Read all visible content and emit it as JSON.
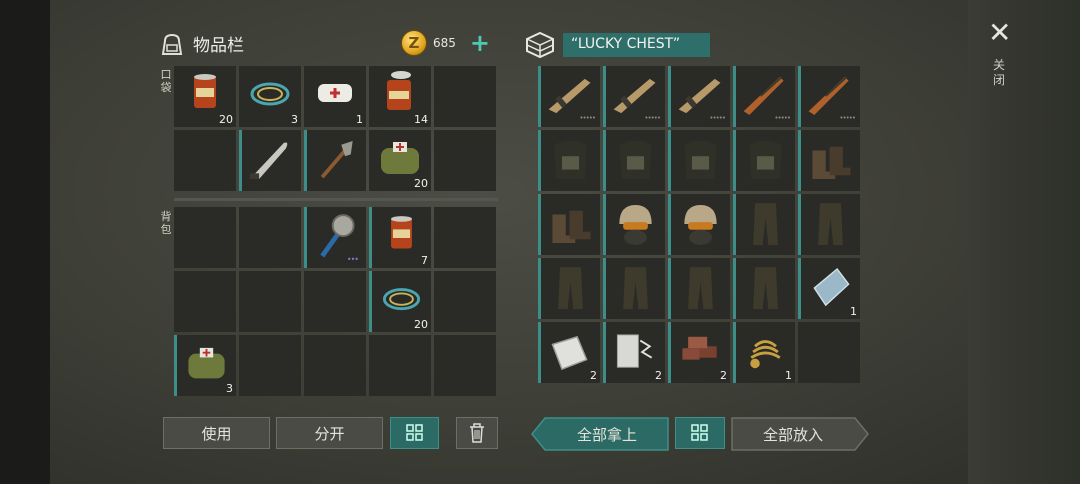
{
  "header": {
    "inventory_title": "物品栏",
    "coins": "685",
    "coin_symbol": "Z",
    "add_label": "+",
    "chest_name": "“LUCKY CHEST”"
  },
  "labels": {
    "pocket": "口袋",
    "backpack": "背包",
    "close": "关闭"
  },
  "pocket": [
    {
      "item": "canned-food",
      "qty": "20"
    },
    {
      "item": "rope",
      "qty": "3"
    },
    {
      "item": "bandage",
      "qty": "1"
    },
    {
      "item": "canned-food-open",
      "qty": "14"
    },
    {
      "item": "",
      "qty": ""
    },
    {
      "item": "",
      "qty": ""
    },
    {
      "item": "machete",
      "qty": ""
    },
    {
      "item": "shovel",
      "qty": ""
    },
    {
      "item": "first-aid-kit",
      "qty": "20"
    },
    {
      "item": "",
      "qty": ""
    }
  ],
  "backpack": [
    {
      "item": "",
      "qty": ""
    },
    {
      "item": "",
      "qty": ""
    },
    {
      "item": "saw-blade-club",
      "qty": ""
    },
    {
      "item": "canned-food",
      "qty": "7"
    },
    {
      "item": "",
      "qty": ""
    },
    {
      "item": "",
      "qty": ""
    },
    {
      "item": "",
      "qty": ""
    },
    {
      "item": "",
      "qty": ""
    },
    {
      "item": "rope",
      "qty": "20"
    },
    {
      "item": "",
      "qty": ""
    },
    {
      "item": "first-aid-kit",
      "qty": "3"
    },
    {
      "item": "",
      "qty": ""
    },
    {
      "item": "",
      "qty": ""
    },
    {
      "item": "",
      "qty": ""
    },
    {
      "item": "",
      "qty": ""
    }
  ],
  "chest": [
    {
      "item": "assault-rifle",
      "qty": ""
    },
    {
      "item": "assault-rifle",
      "qty": ""
    },
    {
      "item": "assault-rifle",
      "qty": ""
    },
    {
      "item": "sks-rifle",
      "qty": ""
    },
    {
      "item": "sks-rifle",
      "qty": ""
    },
    {
      "item": "tactical-vest",
      "qty": ""
    },
    {
      "item": "tactical-vest",
      "qty": ""
    },
    {
      "item": "tactical-vest",
      "qty": ""
    },
    {
      "item": "tactical-vest",
      "qty": ""
    },
    {
      "item": "tactical-boots",
      "qty": ""
    },
    {
      "item": "tactical-boots",
      "qty": ""
    },
    {
      "item": "tactical-helmet",
      "qty": ""
    },
    {
      "item": "tactical-helmet",
      "qty": ""
    },
    {
      "item": "tactical-pants",
      "qty": ""
    },
    {
      "item": "tactical-pants",
      "qty": ""
    },
    {
      "item": "tactical-pants",
      "qty": ""
    },
    {
      "item": "tactical-pants",
      "qty": ""
    },
    {
      "item": "tactical-pants",
      "qty": ""
    },
    {
      "item": "tactical-pants",
      "qty": ""
    },
    {
      "item": "steel-plate",
      "qty": "1"
    },
    {
      "item": "aluminum-sheet",
      "qty": "2"
    },
    {
      "item": "wire",
      "qty": "2"
    },
    {
      "item": "bricks",
      "qty": "2"
    },
    {
      "item": "spring",
      "qty": "1"
    },
    {
      "item": "",
      "qty": ""
    }
  ],
  "buttons": {
    "use": "使用",
    "split": "分开",
    "take_all": "全部拿上",
    "put_all": "全部放入"
  },
  "colors": {
    "accent": "#3c8f88",
    "slot": "#2a2b26",
    "coin": "#e0a420"
  }
}
